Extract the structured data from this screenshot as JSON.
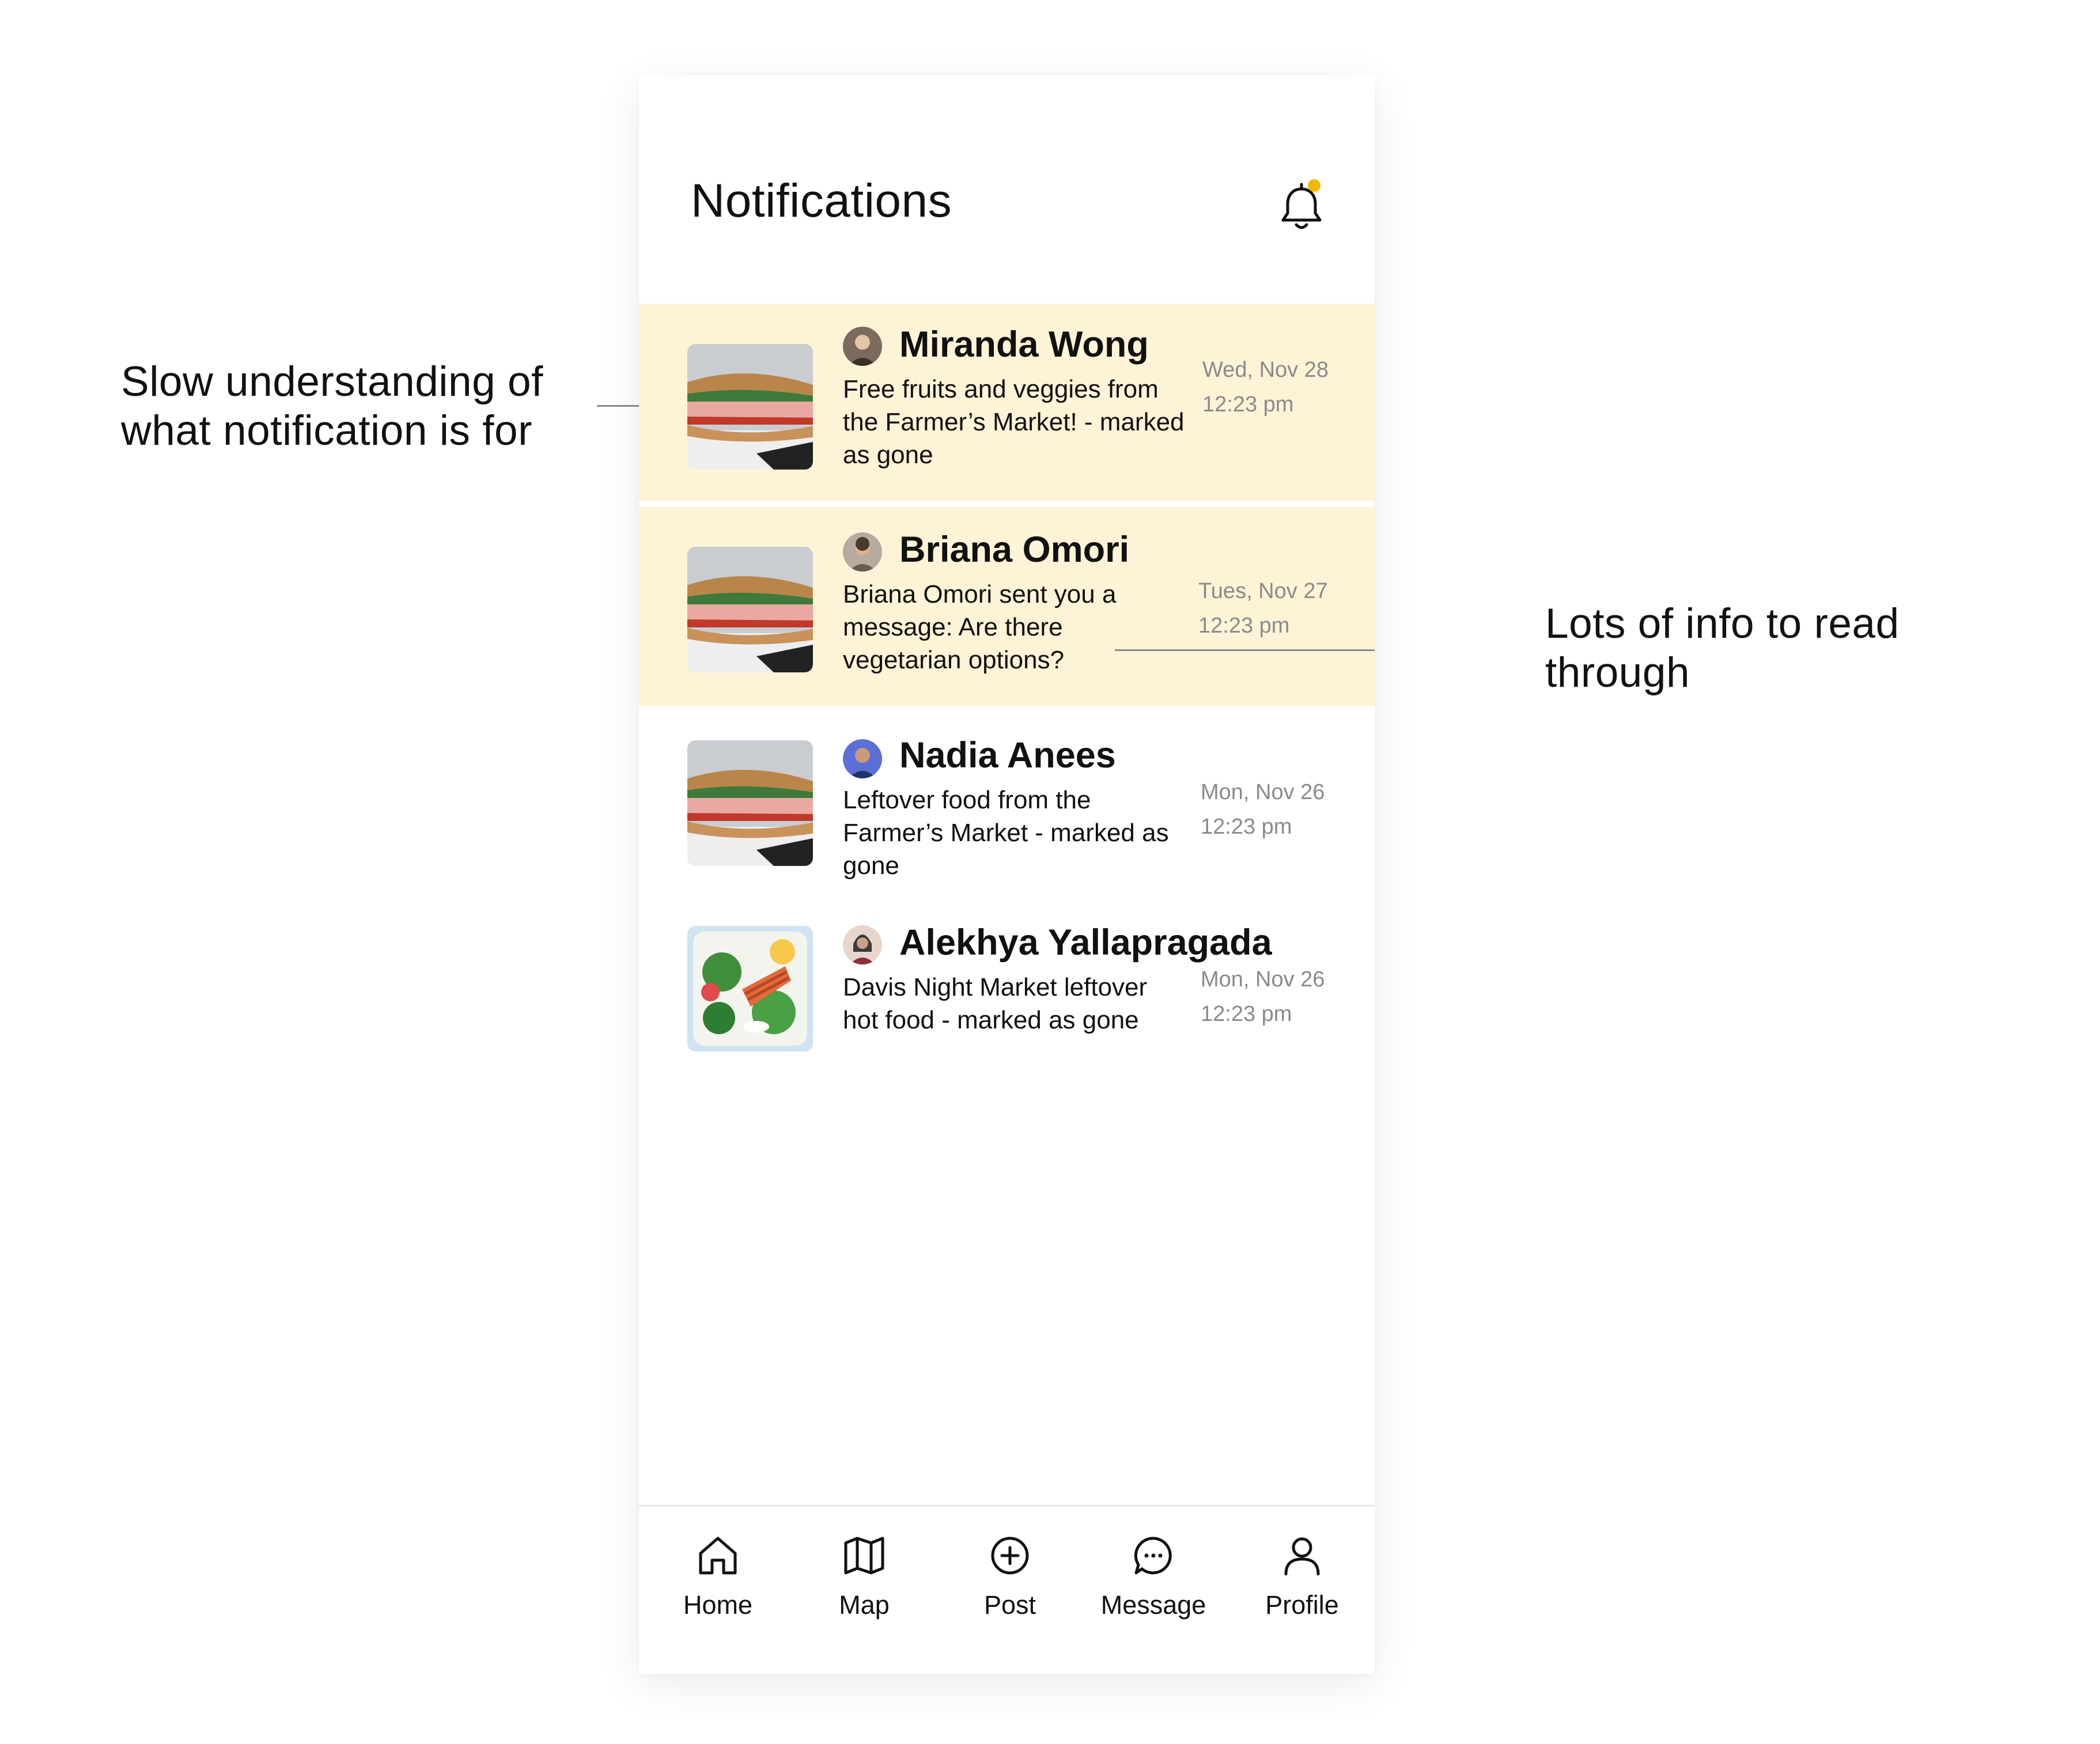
{
  "header": {
    "title": "Notifications",
    "bell_icon": "bell-icon",
    "bell_badge_color": "#f5b800"
  },
  "colors": {
    "unread_background": "#fdf3d6",
    "text": "#111111",
    "muted_text": "#8a8a8a"
  },
  "notifications": [
    {
      "name": "Miranda Wong",
      "message": "Free fruits and veggies from the Farmer’s Market! - marked as gone",
      "date": "Wed, Nov 28",
      "time": "12:23 pm",
      "unread": true,
      "thumbnail": "sandwich-image"
    },
    {
      "name": "Briana Omori",
      "message": "Briana Omori sent you a message: Are there vegetarian options?",
      "date": "Tues, Nov 27",
      "time": "12:23 pm",
      "unread": true,
      "thumbnail": "sandwich-image"
    },
    {
      "name": "Nadia Anees",
      "message": "Leftover food from the Farmer’s Market - marked as gone",
      "date": "Mon, Nov 26",
      "time": "12:23 pm",
      "unread": false,
      "thumbnail": "sandwich-image"
    },
    {
      "name": "Alekhya Yallapragada",
      "message": "Davis Night Market leftover hot food - marked as gone",
      "date": "Mon, Nov 26",
      "time": "12:23 pm",
      "unread": false,
      "thumbnail": "salmon-salad-image"
    }
  ],
  "nav": [
    {
      "label": "Home",
      "icon": "home-icon"
    },
    {
      "label": "Map",
      "icon": "map-icon"
    },
    {
      "label": "Post",
      "icon": "plus-circle-icon"
    },
    {
      "label": "Message",
      "icon": "chat-bubble-icon"
    },
    {
      "label": "Profile",
      "icon": "user-icon"
    }
  ],
  "annotations": {
    "left_line1": "Slow understanding of",
    "left_line2": "what notification is for",
    "right_line1": "Lots of info to read",
    "right_line2": "through"
  }
}
